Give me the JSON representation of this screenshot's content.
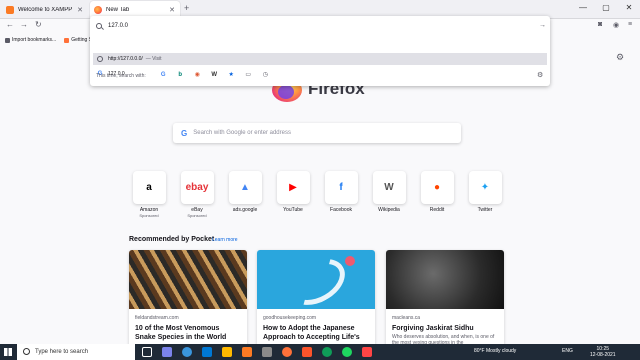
{
  "tabs": [
    {
      "title": "Welcome to XAMPP",
      "favicon": "xampp-icon",
      "active": false
    },
    {
      "title": "New Tab",
      "favicon": "firefox-icon",
      "active": true
    }
  ],
  "url_bar": {
    "value": "127.0.0",
    "suggestions": [
      {
        "text": "http://127.0.0.0/",
        "sub": "— Visit",
        "icon": "globe-icon",
        "highlighted": true
      },
      {
        "text": "127.0.0",
        "sub": "",
        "icon": "google-icon",
        "highlighted": false
      }
    ],
    "search_with_label": "This time, search with:",
    "engines": [
      "Google",
      "Bing",
      "DuckDuckGo",
      "Wikipedia",
      "Bookmarks",
      "Tabs",
      "History"
    ]
  },
  "bookmarks": [
    {
      "label": "Import bookmarks..."
    },
    {
      "label": "Getting St"
    }
  ],
  "newtab": {
    "brand": "Firefox",
    "search_placeholder": "Search with Google or enter address",
    "top_sites": [
      {
        "label": "Amazon",
        "sponsored": "Sponsored",
        "glyph": "a",
        "color": "#000000"
      },
      {
        "label": "eBay",
        "sponsored": "Sponsored",
        "glyph": "ebay",
        "color": "#e53238"
      },
      {
        "label": "ads.google",
        "sponsored": "",
        "glyph": "▲",
        "color": "#4285f4"
      },
      {
        "label": "YouTube",
        "sponsored": "",
        "glyph": "▶",
        "color": "#ff0000"
      },
      {
        "label": "Facebook",
        "sponsored": "",
        "glyph": "f",
        "color": "#1877f2"
      },
      {
        "label": "Wikipedia",
        "sponsored": "",
        "glyph": "W",
        "color": "#555555"
      },
      {
        "label": "Reddit",
        "sponsored": "",
        "glyph": "●",
        "color": "#ff4500"
      },
      {
        "label": "Twitter",
        "sponsored": "",
        "glyph": "✦",
        "color": "#1da1f2"
      }
    ],
    "pocket_heading": "Recommended by Pocket",
    "pocket_more": "Learn more",
    "cards": [
      {
        "source": "fieldandstream.com",
        "title": "10 of the Most Venomous Snake Species in the World",
        "desc": ""
      },
      {
        "source": "goodhousekeeping.com",
        "title": "How to Adopt the Japanese Approach to Accepting Life's",
        "desc": ""
      },
      {
        "source": "macleans.ca",
        "title": "Forgiving Jaskirat Sidhu",
        "desc": "Who deserves absolution, and when, is one of the most vexing questions in the"
      }
    ]
  },
  "taskbar": {
    "search_placeholder": "Type here to search",
    "weather": "80°F  Mostly cloudy",
    "lang": "ENG",
    "time": "10:25",
    "date": "12-08-2021"
  }
}
